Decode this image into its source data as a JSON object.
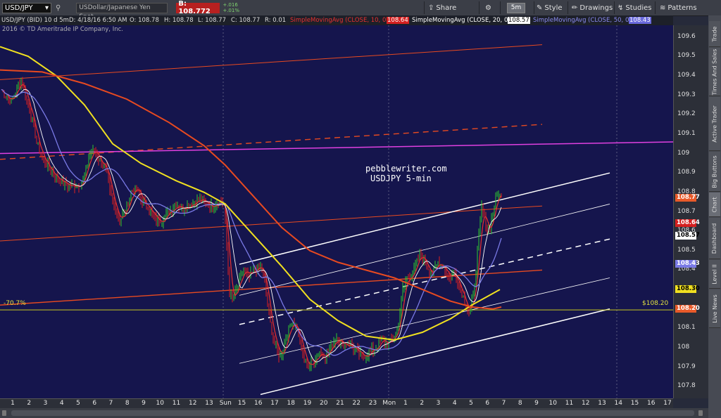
{
  "toolbar": {
    "symbol": "USD/JPY",
    "description": "USDollar/Japanese Yen Spot",
    "bid_label": "B: 108.772",
    "change_top": "+.016",
    "change_bottom": "+.01%",
    "share_label": "Share",
    "timeframe": "5m",
    "style_label": "Style",
    "drawings_label": "Drawings",
    "studies_label": "Studies",
    "patterns_label": "Patterns"
  },
  "statsbar": {
    "symbol": "USD/JPY (BID) 10 d 5m",
    "date": "D: 4/18/16 6:50 AM",
    "open": "O: 108.78",
    "high": "H: 108.78",
    "low": "L: 108.77",
    "close": "C: 108.77",
    "range": "R: 0.01",
    "sma10": "SimpleMovingAvg (CLOSE, 10, 0)",
    "sma10_val": "108.64",
    "sma20": "SimpleMovingAvg (CLOSE, 20, 0)",
    "sma20_val": "108.57",
    "sma50": "SimpleMovingAvg (CLOSE, 50, 0)",
    "sma50_val": "108.43"
  },
  "copyright": "2016 © TD Ameritrade IP Company, Inc.",
  "watermark": {
    "line1": "pebblewriter.com",
    "line2": "USDJPY 5-min"
  },
  "annotations": {
    "fib": "-70.7%",
    "level": "$108.20"
  },
  "y_axis": {
    "ticks": [
      "109.6",
      "109.5",
      "109.4",
      "109.3",
      "109.2",
      "109.1",
      "109",
      "108.9",
      "108.8",
      "108.7",
      "108.6",
      "108.5",
      "108.4",
      "108.3",
      "108.2",
      "108.1",
      "108",
      "107.9",
      "107.8"
    ],
    "badges": [
      {
        "label": "108.77",
        "value": 108.772,
        "color": "#e85a2a",
        "text": "#fff"
      },
      {
        "label": "108.64",
        "value": 108.64,
        "color": "#d42020",
        "text": "#fff"
      },
      {
        "label": "108.57",
        "value": 108.575,
        "color": "#ffffff",
        "text": "#000"
      },
      {
        "label": "108.43",
        "value": 108.43,
        "color": "#7a7ae6",
        "text": "#fff"
      },
      {
        "label": "108.30",
        "value": 108.3,
        "color": "#f0e020",
        "text": "#000"
      },
      {
        "label": "108.20",
        "value": 108.2,
        "color": "#e85a2a",
        "text": "#fff"
      }
    ]
  },
  "x_axis": {
    "labels": [
      "1",
      "2",
      "3",
      "4",
      "5",
      "6",
      "7",
      "8",
      "9",
      "10",
      "11",
      "12",
      "13",
      "Sun",
      "15",
      "16",
      "17",
      "18",
      "19",
      "20",
      "21",
      "22",
      "23",
      "Mon",
      "1",
      "2",
      "3",
      "4",
      "5",
      "6",
      "7",
      "8",
      "9",
      "10",
      "11",
      "12",
      "13",
      "14",
      "15",
      "16",
      "17"
    ]
  },
  "sidebar": {
    "tabs": [
      "Trade",
      "Times And Sales",
      "Active Trader",
      "Big Buttons",
      "Chart",
      "Dashboard",
      "Level II",
      "Live News"
    ]
  },
  "chart_data": {
    "type": "line",
    "title": "USD/JPY (BID) 10 d 5m",
    "ylim": [
      107.74,
      109.66
    ],
    "price_x": [
      0,
      1,
      2,
      3,
      4,
      5,
      6,
      7,
      8,
      9,
      10,
      11,
      12,
      13,
      14,
      15,
      16,
      17,
      18,
      19,
      20,
      21,
      22,
      23,
      24,
      25,
      26,
      27,
      28,
      29,
      30,
      31,
      32,
      33,
      34,
      35,
      36,
      37,
      38,
      39,
      40,
      41,
      42,
      43,
      44,
      45,
      46,
      47,
      48,
      49,
      50,
      51,
      52,
      53,
      54,
      55,
      56,
      57,
      58,
      59,
      60,
      61,
      62,
      63,
      64,
      65,
      66,
      67,
      68,
      69,
      70,
      71,
      72,
      73,
      74,
      75,
      76,
      77,
      78,
      79,
      80,
      81,
      82,
      83,
      84,
      85,
      86,
      87,
      88,
      89,
      90,
      91,
      92,
      93,
      94,
      95,
      96,
      97,
      98,
      99,
      100,
      101,
      102,
      103,
      104,
      105,
      106,
      107,
      108,
      109,
      110,
      111,
      112,
      113,
      114,
      115,
      116,
      117,
      118,
      119,
      120,
      121,
      122,
      123,
      124,
      125,
      126,
      127,
      128,
      129,
      130,
      131,
      132,
      133,
      134,
      135,
      136,
      137,
      138,
      139,
      140,
      141,
      142,
      143,
      144,
      145,
      146,
      147,
      148,
      149,
      150,
      151,
      152,
      153,
      154,
      155,
      156,
      157,
      158,
      159,
      160,
      161,
      162,
      163,
      164,
      165,
      166,
      167,
      168,
      169,
      170,
      171,
      172,
      173,
      174,
      175,
      176,
      177,
      178,
      179,
      180,
      181,
      182,
      183,
      184,
      185,
      186,
      187,
      188,
      189,
      190,
      191,
      192,
      193,
      194,
      195,
      196,
      197,
      198,
      199,
      200,
      201,
      202,
      203,
      204,
      205,
      206,
      207,
      208,
      209,
      210,
      211,
      212,
      213,
      214,
      215,
      216,
      217,
      218,
      219,
      220,
      221,
      222,
      223,
      224,
      225,
      226,
      227,
      228,
      229,
      230,
      231,
      232,
      233,
      234,
      235,
      236,
      237,
      238,
      239,
      240,
      241,
      242,
      243,
      244,
      245,
      246,
      247,
      248,
      249,
      250,
      251,
      252,
      253,
      254,
      255,
      256,
      257,
      258,
      259,
      260,
      261,
      262,
      263,
      264,
      265,
      266,
      267,
      268,
      269,
      270,
      271,
      272,
      273,
      274,
      275,
      276,
      277,
      278,
      279,
      280,
      281,
      282,
      283,
      284,
      285,
      286,
      287,
      288,
      289,
      290,
      291,
      292,
      293,
      294,
      295,
      296,
      297,
      298,
      299,
      300,
      301,
      302,
      303,
      304,
      305,
      306,
      307,
      308,
      309,
      310,
      311,
      312,
      313,
      314,
      315,
      316,
      317,
      318,
      319,
      320,
      321,
      322,
      323,
      324,
      325,
      326,
      327,
      328,
      329,
      330,
      331,
      332,
      333,
      334,
      335,
      336,
      337,
      338,
      339,
      340,
      341,
      342,
      343,
      344,
      345,
      346,
      347,
      348,
      349,
      350,
      351,
      352,
      353,
      354,
      355,
      356,
      357,
      358,
      359,
      360
    ],
    "anchors": [
      [
        0,
        109.34
      ],
      [
        8,
        109.3
      ],
      [
        16,
        109.27
      ],
      [
        22,
        109.32
      ],
      [
        30,
        109.38
      ],
      [
        36,
        109.3
      ],
      [
        44,
        109.2
      ],
      [
        52,
        109.06
      ],
      [
        60,
        108.98
      ],
      [
        70,
        108.92
      ],
      [
        80,
        108.88
      ],
      [
        90,
        108.85
      ],
      [
        100,
        108.83
      ],
      [
        110,
        108.84
      ],
      [
        118,
        108.86
      ],
      [
        126,
        108.98
      ],
      [
        134,
        109.02
      ],
      [
        142,
        108.96
      ],
      [
        150,
        108.92
      ],
      [
        156,
        108.8
      ],
      [
        162,
        108.73
      ],
      [
        170,
        108.66
      ],
      [
        178,
        108.7
      ],
      [
        186,
        108.8
      ],
      [
        194,
        108.82
      ],
      [
        202,
        108.75
      ],
      [
        210,
        108.73
      ],
      [
        220,
        108.66
      ],
      [
        230,
        108.66
      ],
      [
        240,
        108.7
      ],
      [
        250,
        108.74
      ],
      [
        260,
        108.72
      ],
      [
        270,
        108.74
      ],
      [
        280,
        108.76
      ],
      [
        290,
        108.75
      ],
      [
        300,
        108.73
      ],
      [
        310,
        108.76
      ],
      [
        318,
        108.74
      ],
      [
        322,
        108.52
      ],
      [
        326,
        108.28
      ],
      [
        330,
        108.24
      ],
      [
        338,
        108.32
      ],
      [
        346,
        108.4
      ],
      [
        354,
        108.36
      ],
      [
        362,
        108.4
      ],
      [
        370,
        108.42
      ],
      [
        376,
        108.34
      ],
      [
        382,
        108.16
      ],
      [
        390,
        108.02
      ],
      [
        398,
        107.95
      ],
      [
        406,
        108.05
      ],
      [
        414,
        108.14
      ],
      [
        422,
        108.1
      ],
      [
        430,
        107.96
      ],
      [
        438,
        107.9
      ],
      [
        446,
        107.94
      ],
      [
        454,
        107.98
      ],
      [
        462,
        107.96
      ],
      [
        470,
        108.0
      ],
      [
        478,
        108.06
      ],
      [
        486,
        108.02
      ],
      [
        494,
        108.02
      ],
      [
        502,
        108.0
      ],
      [
        510,
        107.96
      ],
      [
        518,
        107.96
      ],
      [
        526,
        107.98
      ],
      [
        534,
        108.0
      ],
      [
        542,
        108.04
      ],
      [
        550,
        108.02
      ],
      [
        558,
        108.04
      ],
      [
        566,
        108.12
      ],
      [
        572,
        108.3
      ],
      [
        578,
        108.36
      ],
      [
        586,
        108.38
      ],
      [
        592,
        108.44
      ],
      [
        598,
        108.48
      ],
      [
        606,
        108.42
      ],
      [
        614,
        108.38
      ],
      [
        622,
        108.44
      ],
      [
        630,
        108.42
      ],
      [
        638,
        108.36
      ],
      [
        646,
        108.38
      ],
      [
        654,
        108.3
      ],
      [
        660,
        108.24
      ],
      [
        666,
        108.18
      ],
      [
        672,
        108.26
      ],
      [
        676,
        108.4
      ],
      [
        680,
        108.58
      ],
      [
        684,
        108.72
      ],
      [
        688,
        108.66
      ],
      [
        692,
        108.6
      ],
      [
        696,
        108.63
      ],
      [
        700,
        108.7
      ],
      [
        704,
        108.76
      ],
      [
        708,
        108.8
      ],
      [
        712,
        108.77
      ]
    ],
    "series": [
      {
        "name": "SimpleMovingAvg (CLOSE, 10, 0)",
        "color": "#e83030",
        "last": 108.64
      },
      {
        "name": "SimpleMovingAvg (CLOSE, 20, 0)",
        "color": "#ffffff",
        "last": 108.57
      },
      {
        "name": "SimpleMovingAvg (CLOSE, 50, 0)",
        "color": "#7a7ae6",
        "last": 108.43
      }
    ],
    "overlays": [
      {
        "kind": "sma",
        "color": "#f0e020",
        "points": [
          [
            0,
            109.55
          ],
          [
            40,
            109.5
          ],
          [
            80,
            109.4
          ],
          [
            120,
            109.25
          ],
          [
            160,
            109.05
          ],
          [
            200,
            108.95
          ],
          [
            250,
            108.86
          ],
          [
            290,
            108.8
          ],
          [
            320,
            108.74
          ],
          [
            360,
            108.58
          ],
          [
            400,
            108.42
          ],
          [
            440,
            108.25
          ],
          [
            480,
            108.14
          ],
          [
            520,
            108.06
          ],
          [
            560,
            108.04
          ],
          [
            600,
            108.08
          ],
          [
            640,
            108.15
          ],
          [
            670,
            108.22
          ],
          [
            690,
            108.26
          ],
          [
            710,
            108.3
          ]
        ]
      },
      {
        "kind": "sma",
        "color": "#e84a20",
        "points": [
          [
            0,
            109.43
          ],
          [
            60,
            109.42
          ],
          [
            120,
            109.36
          ],
          [
            180,
            109.28
          ],
          [
            240,
            109.16
          ],
          [
            290,
            109.04
          ],
          [
            320,
            108.94
          ],
          [
            360,
            108.78
          ],
          [
            400,
            108.62
          ],
          [
            440,
            108.5
          ],
          [
            480,
            108.44
          ],
          [
            520,
            108.4
          ],
          [
            560,
            108.36
          ],
          [
            600,
            108.3
          ],
          [
            640,
            108.24
          ],
          [
            670,
            108.21
          ],
          [
            700,
            108.2
          ],
          [
            712,
            108.21
          ]
        ]
      }
    ],
    "trendlines": [
      {
        "color": "#e84a20",
        "width": 1,
        "dash": false,
        "from": [
          0,
          109.38
        ],
        "to": [
          770,
          109.56
        ]
      },
      {
        "color": "#e84a20",
        "width": 1.4,
        "dash": true,
        "from": [
          0,
          108.97
        ],
        "to": [
          770,
          109.15
        ]
      },
      {
        "color": "#e040e0",
        "width": 1.5,
        "dash": false,
        "from": [
          0,
          109.0
        ],
        "to": [
          956,
          109.06
        ]
      },
      {
        "color": "#e84a20",
        "width": 1,
        "dash": false,
        "from": [
          0,
          108.55
        ],
        "to": [
          770,
          108.73
        ]
      },
      {
        "color": "#e84a20",
        "width": 1.4,
        "dash": false,
        "from": [
          0,
          108.22
        ],
        "to": [
          770,
          108.4
        ]
      },
      {
        "color": "#ffffff",
        "width": 1.5,
        "dash": false,
        "from": [
          340,
          108.43
        ],
        "to": [
          866,
          108.9
        ]
      },
      {
        "color": "#ffffff",
        "width": 0.8,
        "dash": false,
        "from": [
          340,
          108.27
        ],
        "to": [
          866,
          108.74
        ]
      },
      {
        "color": "#ffffff",
        "width": 1.5,
        "dash": true,
        "from": [
          340,
          108.12
        ],
        "to": [
          866,
          108.56
        ]
      },
      {
        "color": "#ffffff",
        "width": 0.8,
        "dash": false,
        "from": [
          340,
          107.92
        ],
        "to": [
          866,
          108.36
        ]
      },
      {
        "color": "#ffffff",
        "width": 1.5,
        "dash": false,
        "from": [
          370,
          107.76
        ],
        "to": [
          866,
          108.2
        ]
      },
      {
        "color": "#c8c820",
        "width": 1,
        "dash": false,
        "from": [
          0,
          108.195
        ],
        "to": [
          956,
          108.195
        ]
      }
    ]
  }
}
